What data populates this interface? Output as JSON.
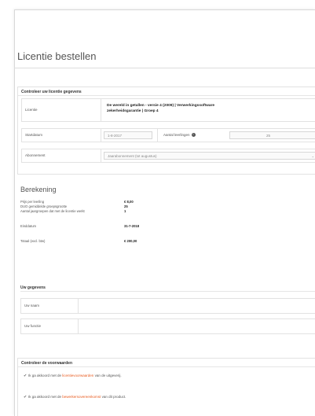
{
  "page": {
    "title": "Licentie bestellen"
  },
  "license_section": {
    "heading": "Controleer uw licentie gegevens",
    "license_label": "Licentie",
    "license_value_line1": "De wereld in getallen - versie 4 (2009) | Verwerkingssoftware",
    "license_value_line2": "zekerheidsgarantie | Groep 4",
    "startdate_label": "Startdatum",
    "startdate_value": "1-8-2017",
    "students_label": "Aantal leerlingen",
    "students_value": "25",
    "subscription_label": "Abonnement",
    "subscription_value": "Jaarabonnement (tot augustus)"
  },
  "calculation": {
    "title": "Berekening",
    "rows": [
      {
        "label": "Prijs per leerling",
        "value": "€ 8,00"
      },
      {
        "label": "DUO gemiddelde groepsgrootte",
        "value": "25"
      },
      {
        "label": "Aantal jaargroepen dat met de licentie werkt",
        "value": "1"
      }
    ],
    "enddate_label": "Einddatum",
    "enddate_value": "31-7-2018",
    "total_label": "Totaal (excl. btw)",
    "total_value": "€ 200,00"
  },
  "personal_section": {
    "heading": "Uw gegevens",
    "name_label": "Uw naam",
    "function_label": "Uw functie"
  },
  "terms_section": {
    "heading": "Controleer de voorwaarden",
    "check1_before": "Ik ga akkoord met de ",
    "check1_link": "licentievoorwaarden",
    "check1_after": " van de uitgeverij.",
    "check2_before": "Ik ga akkoord met de ",
    "check2_link": "bewerkersovereenkomst",
    "check2_after": " van dit product."
  },
  "icons": {
    "info": "info-icon",
    "check": "check-icon",
    "dropdown": "chevron-icon"
  },
  "colors": {
    "link": "#e85a1e"
  }
}
